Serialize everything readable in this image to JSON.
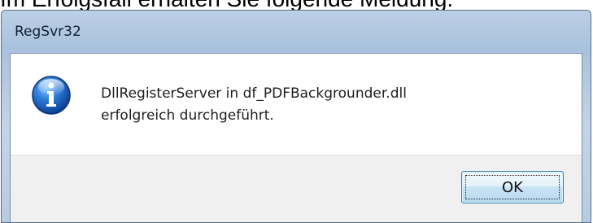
{
  "background_caption": "Im Erfolgsfall erhalten Sie folgende Meldung:",
  "dialog": {
    "title": "RegSvr32",
    "icon": "info-icon",
    "message_line_1": "DllRegisterServer in df_PDFBackgrounder.dll",
    "message_line_2": "erfolgreich durchgeführt.",
    "ok_label": "OK"
  },
  "colors": {
    "frame": "#b6cbe2",
    "button_bar": "#f0f0f0",
    "info_icon": "#1d67c2",
    "ok_border": "#3c7fb1"
  }
}
